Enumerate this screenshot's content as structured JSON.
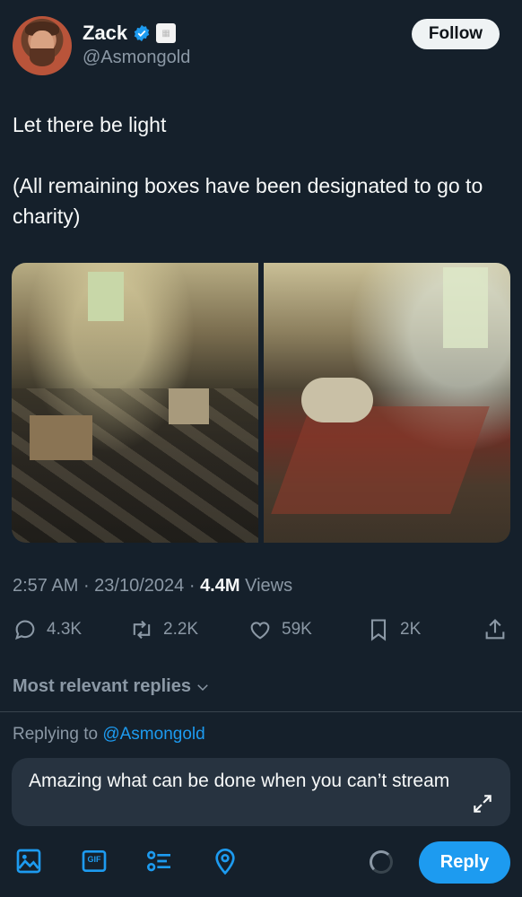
{
  "author": {
    "name": "Zack",
    "handle": "@Asmongold",
    "follow_label": "Follow"
  },
  "tweet": {
    "text": "Let there be light\n\n(All remaining boxes have been designated to go to charity)",
    "time": "2:57 AM",
    "date": "23/10/2024",
    "views_count": "4.4M",
    "views_label": "Views"
  },
  "actions": {
    "replies": "4.3K",
    "retweets": "2.2K",
    "likes": "59K",
    "bookmarks": "2K"
  },
  "replies_section": {
    "sort_label": "Most relevant replies",
    "replying_prefix": "Replying to",
    "replying_handle": "@Asmongold"
  },
  "composer": {
    "text": "Amazing what can be done when you can’t stream",
    "reply_label": "Reply",
    "gif_label": "GIF"
  },
  "icons": [
    "verified-icon",
    "reply-icon",
    "retweet-icon",
    "like-icon",
    "bookmark-icon",
    "share-icon",
    "chevron-down-icon",
    "expand-icon",
    "image-icon",
    "gif-icon",
    "poll-icon",
    "location-icon"
  ],
  "colors": {
    "background": "#15202b",
    "accent": "#1d9bf0",
    "muted": "#8b98a5"
  }
}
